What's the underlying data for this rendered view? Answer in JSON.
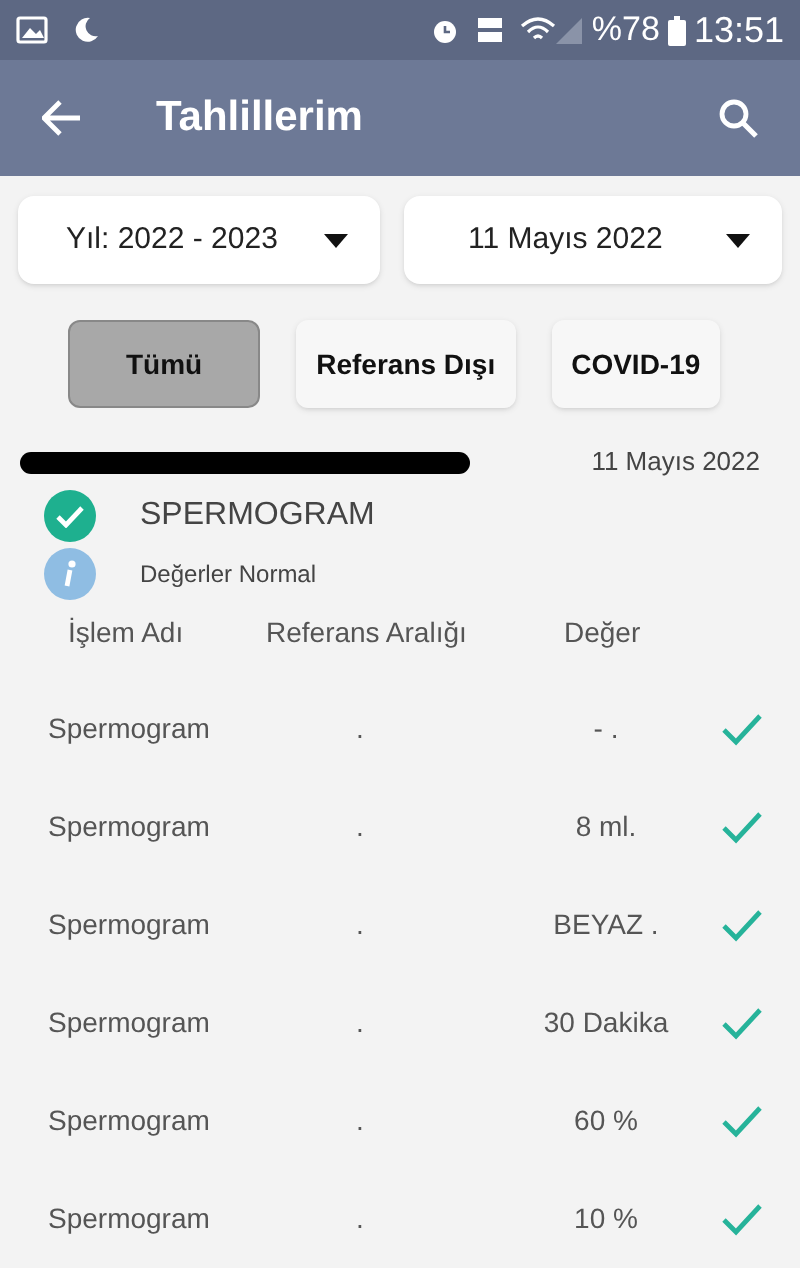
{
  "status_bar": {
    "battery": "%78",
    "time": "13:51"
  },
  "header": {
    "title": "Tahlillerim"
  },
  "filters": {
    "year": "Yıl: 2022 - 2023",
    "date": "11 Mayıs 2022"
  },
  "tabs": [
    {
      "label": "Tümü",
      "selected": true
    },
    {
      "label": "Referans Dışı",
      "selected": false
    },
    {
      "label": "COVID-19",
      "selected": false
    }
  ],
  "result": {
    "date": "11 Mayıs 2022",
    "test_name": "SPERMOGRAM",
    "status": "Değerler Normal",
    "normal": true
  },
  "table": {
    "columns": [
      "İşlem Adı",
      "Referans Aralığı",
      "Değer"
    ],
    "rows": [
      {
        "name": "Spermogram",
        "range": ".",
        "value": "- .",
        "normal": true
      },
      {
        "name": "Spermogram",
        "range": ".",
        "value": "8 ml.",
        "normal": true
      },
      {
        "name": "Spermogram",
        "range": ".",
        "value": "BEYAZ .",
        "normal": true
      },
      {
        "name": "Spermogram",
        "range": ".",
        "value": "30 Dakika",
        "normal": true
      },
      {
        "name": "Spermogram",
        "range": ".",
        "value": "60 %",
        "normal": true
      },
      {
        "name": "Spermogram",
        "range": ".",
        "value": "10 %",
        "normal": true
      }
    ]
  }
}
